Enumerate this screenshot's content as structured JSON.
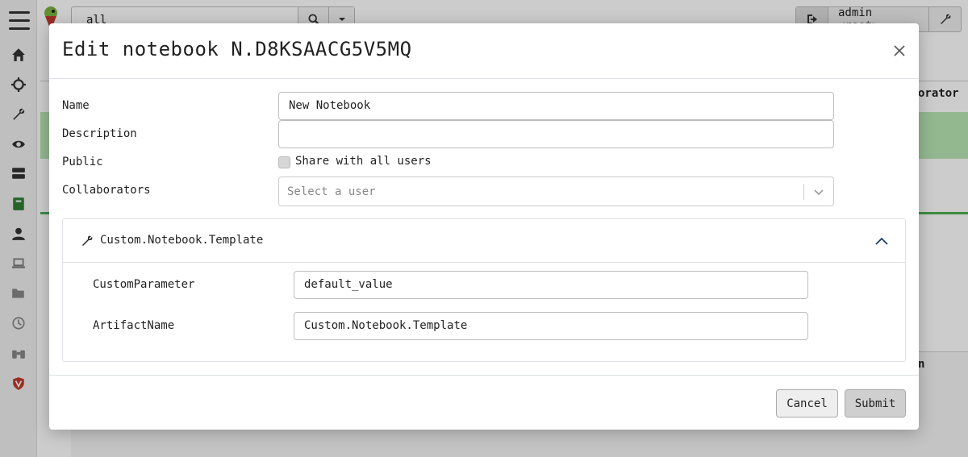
{
  "app": {
    "search": {
      "value": "all"
    },
    "user": {
      "name": "admin",
      "role": "<root>"
    },
    "bg_columns": {
      "collaborators_partial": "orator",
      "name_partial": "n"
    }
  },
  "modal": {
    "title": "Edit notebook N.D8KSAACG5V5MQ",
    "fields": {
      "name_label": "Name",
      "name_value": "New Notebook",
      "description_label": "Description",
      "description_value": "",
      "public_label": "Public",
      "share_label": "Share with all users",
      "share_checked": false,
      "collaborators_label": "Collaborators",
      "collaborators_placeholder": "Select a user"
    },
    "template": {
      "title": "Custom.Notebook.Template",
      "icon": "wrench-icon",
      "params": [
        {
          "label": "CustomParameter",
          "value": "default_value"
        },
        {
          "label": "ArtifactName",
          "value": "Custom.Notebook.Template"
        }
      ]
    },
    "buttons": {
      "cancel": "Cancel",
      "submit": "Submit"
    }
  },
  "colors": {
    "accent_green": "#4caf50",
    "row_highlight": "#b8e6b3",
    "sidebar_red": "#c0392b",
    "notebook_green": "#2e7d32"
  }
}
